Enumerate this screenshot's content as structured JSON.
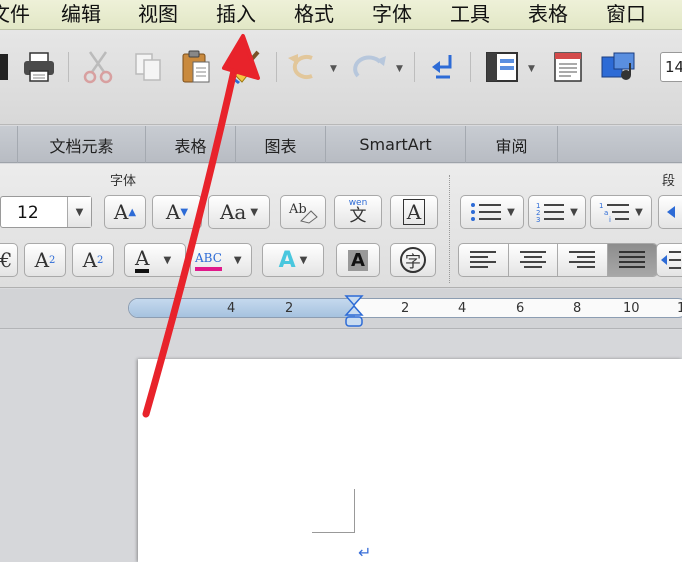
{
  "menubar": {
    "items": [
      "文件",
      "编辑",
      "视图",
      "插入",
      "格式",
      "字体",
      "工具",
      "表格",
      "窗口"
    ]
  },
  "toolbar": {
    "icons": [
      "save-icon",
      "print-icon",
      "cut-icon",
      "copy-icon",
      "paste-icon",
      "format-painter-icon",
      "undo-icon",
      "redo-icon",
      "paragraph-mark-icon",
      "sidebar-icon",
      "gallery-icon",
      "media-browser-icon"
    ],
    "zoom_value": "14"
  },
  "ribbon_tabs": [
    "文档元素",
    "表格",
    "图表",
    "SmartArt",
    "审阅"
  ],
  "ribbon": {
    "font_group_label": "字体",
    "paragraph_group_label": "段",
    "font_size": "12",
    "pinyin_label": "wen",
    "pinyin_char": "文",
    "enclosed_char": "字",
    "highlight_sample": "ABC",
    "accent_color": "#e0198a",
    "text_effect_color": "#49c7de"
  },
  "ruler": {
    "labels": [
      "4",
      "2",
      "2",
      "4",
      "6",
      "8",
      "10",
      "1"
    ]
  },
  "annotation": {
    "color": "#e8232b"
  }
}
